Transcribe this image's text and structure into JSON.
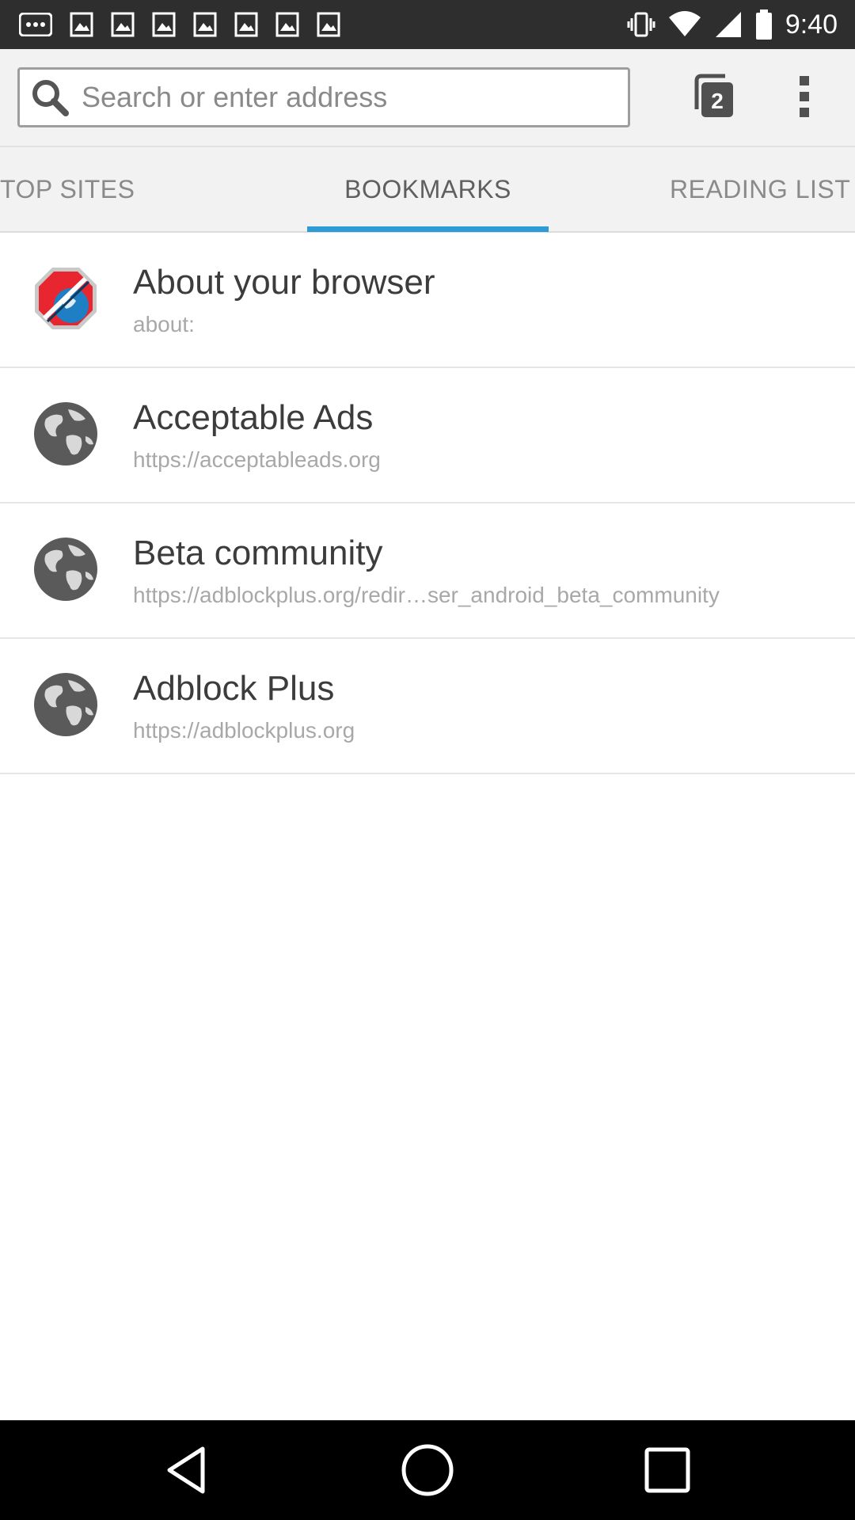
{
  "status_bar": {
    "time": "9:40",
    "left_icons": [
      "more-icon",
      "image-icon",
      "image-icon",
      "image-icon",
      "image-icon",
      "image-icon",
      "image-icon",
      "image-icon"
    ],
    "right_icons": [
      "vibrate-icon",
      "wifi-icon",
      "signal-icon",
      "battery-icon"
    ]
  },
  "toolbar": {
    "search_placeholder": "Search or enter address",
    "tab_count": "2"
  },
  "tabs": [
    {
      "label": "TOP SITES",
      "active": false
    },
    {
      "label": "BOOKMARKS",
      "active": true
    },
    {
      "label": "READING LIST",
      "active": false
    }
  ],
  "bookmarks": [
    {
      "title": "About your browser",
      "url": "about:",
      "icon": "browser-logo-icon"
    },
    {
      "title": "Acceptable Ads",
      "url": "https://acceptableads.org",
      "icon": "globe-icon"
    },
    {
      "title": "Beta community",
      "url": "https://adblockplus.org/redir…ser_android_beta_community",
      "icon": "globe-icon"
    },
    {
      "title": "Adblock Plus",
      "url": "https://adblockplus.org",
      "icon": "globe-icon"
    }
  ],
  "nav_bar": {
    "buttons": [
      "back-icon",
      "home-icon",
      "recents-icon"
    ]
  },
  "colors": {
    "accent": "#2e9bd6",
    "status_bar": "#2e2e2e",
    "nav_bar": "#000000"
  }
}
